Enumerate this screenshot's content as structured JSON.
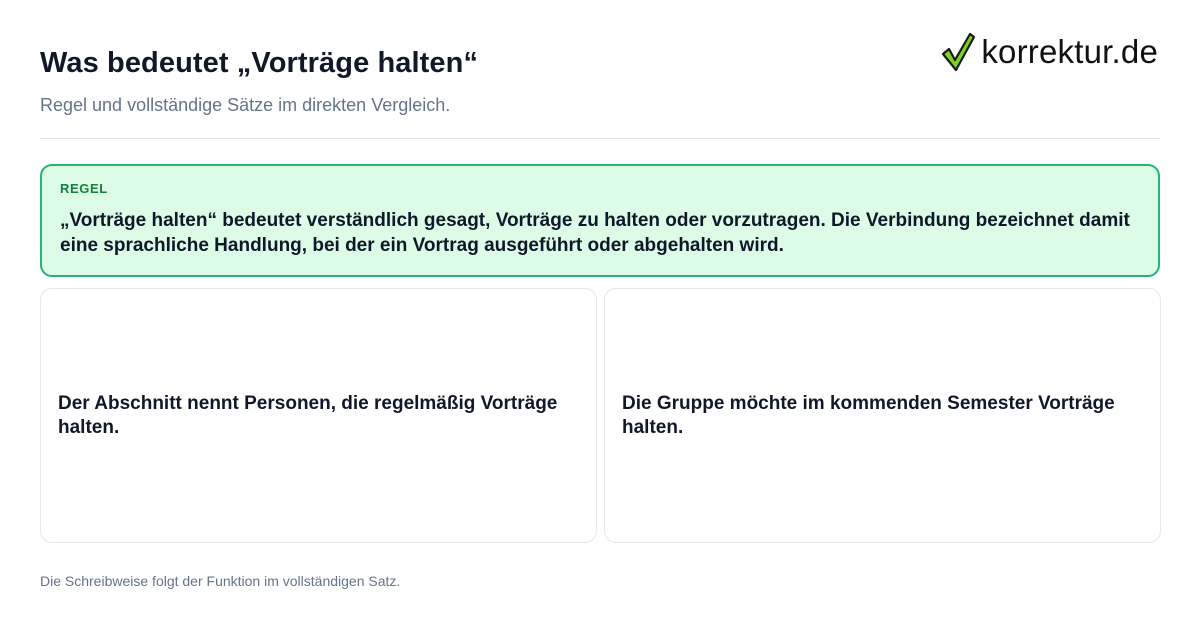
{
  "header": {
    "title": "Was bedeutet „Vorträge halten“",
    "subtitle": "Regel und vollständige Sätze im direkten Vergleich."
  },
  "logo": {
    "text": "korrektur.de",
    "icon": "checkmark-icon",
    "icon_color": "#7ed321"
  },
  "rule": {
    "label": "REGEL",
    "text": "„Vorträge halten“ bedeutet verständlich gesagt, Vorträge zu halten oder vorzutragen. Die Verbindung bezeichnet damit eine sprachliche Handlung, bei der ein Vortrag ausgeführt oder abgehalten wird."
  },
  "examples": [
    {
      "text": "Der Abschnitt nennt Personen, die regelmäßig Vorträge halten."
    },
    {
      "text": "Die Gruppe möchte im kommenden Semester Vorträge halten."
    }
  ],
  "footer": {
    "note": "Die Schreibweise folgt der Funktion im vollständigen Satz."
  },
  "colors": {
    "rule_background": "#dcfce7",
    "rule_border": "#22b573",
    "rule_label": "#15803d",
    "muted_text": "#64748b"
  }
}
